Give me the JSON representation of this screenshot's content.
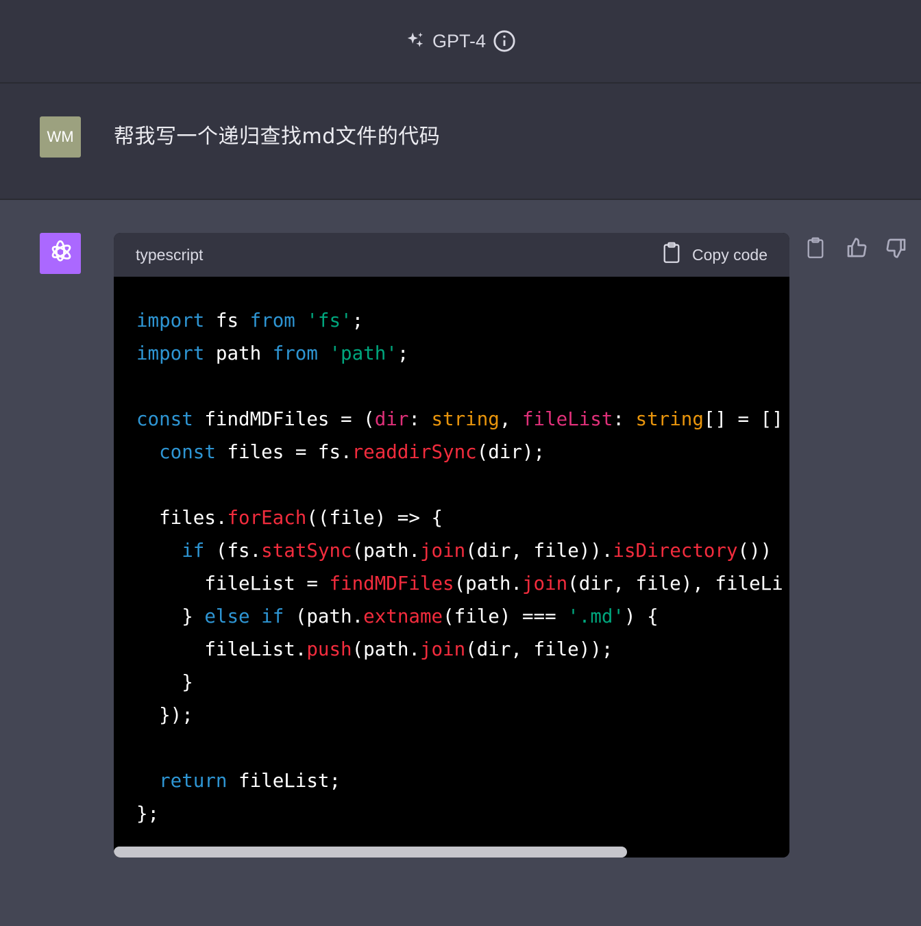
{
  "header": {
    "model_name": "GPT-4"
  },
  "user": {
    "avatar_initials": "WM",
    "message": "帮我写一个递归查找md文件的代码"
  },
  "assistant": {
    "code_language": "typescript",
    "copy_label": "Copy code",
    "code_lines": [
      "import fs from 'fs';",
      "import path from 'path';",
      "",
      "const findMDFiles = (dir: string, fileList: string[] = []",
      "  const files = fs.readdirSync(dir);",
      "",
      "  files.forEach((file) => {",
      "    if (fs.statSync(path.join(dir, file)).isDirectory())",
      "      fileList = findMDFiles(path.join(dir, file), fileLi",
      "    } else if (path.extname(file) === '.md') {",
      "      fileList.push(path.join(dir, file));",
      "    }",
      "  });",
      "",
      "  return fileList;",
      "};"
    ]
  },
  "colors": {
    "accent_gpt": "#ab68ff",
    "user_avatar": "#9ca17f",
    "keyword": "#2e95d3",
    "string": "#00a67d",
    "function": "#f22c3d",
    "type": "#e9950c"
  },
  "scroll": {
    "horizontal_visible_fraction": 0.76
  }
}
